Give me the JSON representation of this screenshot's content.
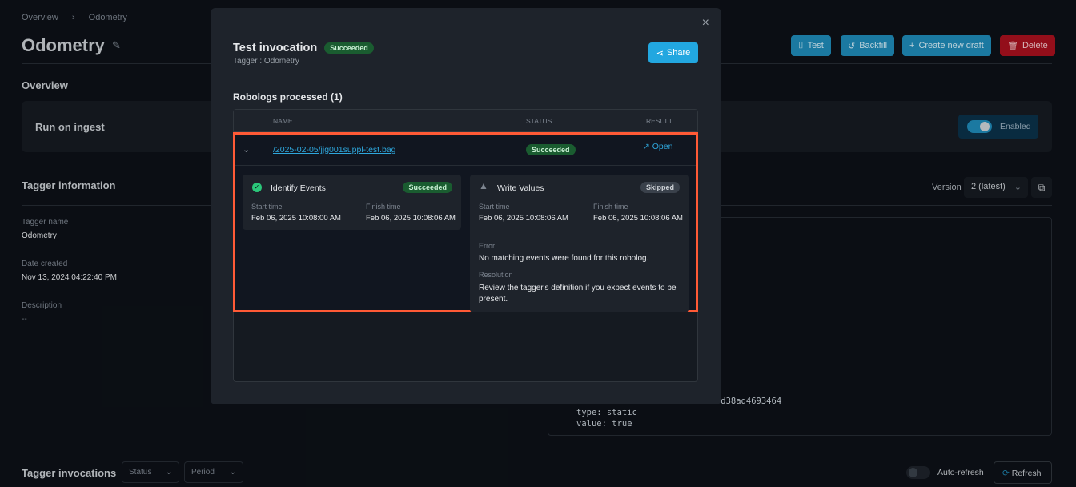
{
  "breadcrumb": {
    "items": [
      "Overview",
      "Odometry"
    ]
  },
  "page": {
    "title": "Odometry"
  },
  "actions": {
    "test": "Test",
    "backfill": "Backfill",
    "create_draft": "Create new draft",
    "delete": "Delete"
  },
  "overview": {
    "heading": "Overview",
    "run_on_ingest": "Run on ingest",
    "toggle_label": "Enabled",
    "toggle_on": true
  },
  "tagger_info": {
    "heading": "Tagger information",
    "version_label": "Version",
    "version_value": "2 (latest)",
    "fields": [
      {
        "label": "Tagger name",
        "value": "Odometry"
      },
      {
        "label": "Date created",
        "value": "Nov 13, 2024 04:22:40 PM"
      },
      {
        "label": "Description",
        "value": "--"
      }
    ],
    "code_lines": [
      "194-d38ad4693464",
      "type: static",
      "value: true"
    ]
  },
  "invocations": {
    "heading": "Tagger invocations",
    "status_filter": "Status",
    "period_filter": "Period",
    "auto_refresh": "Auto-refresh",
    "auto_refresh_on": false,
    "refresh": "Refresh"
  },
  "modal": {
    "title": "Test invocation",
    "status": "Succeeded",
    "subtitle": "Tagger : Odometry",
    "share": "Share",
    "section": "Robologs processed (1)",
    "columns": [
      "NAME",
      "STATUS",
      "RESULT"
    ],
    "row": {
      "name": "/2025-02-05/jjg001suppl-test.bag",
      "status": "Succeeded",
      "open": "Open"
    },
    "steps": [
      {
        "name": "Identify Events",
        "status": "Succeeded",
        "start_label": "Start time",
        "start": "Feb 06, 2025 10:08:00 AM",
        "finish_label": "Finish time",
        "finish": "Feb 06, 2025 10:08:06 AM"
      },
      {
        "name": "Write Values",
        "status": "Skipped",
        "start_label": "Start time",
        "start": "Feb 06, 2025 10:08:06 AM",
        "finish_label": "Finish time",
        "finish": "Feb 06, 2025 10:08:06 AM",
        "error_label": "Error",
        "error": "No matching events were found for this robolog.",
        "resolution_label": "Resolution",
        "resolution": "Review the tagger's definition if you expect events to be present."
      }
    ]
  },
  "colors": {
    "accent": "#1f8ab8",
    "danger": "#a8101e",
    "success": "#1a5c30",
    "highlight": "#ff5a36"
  }
}
